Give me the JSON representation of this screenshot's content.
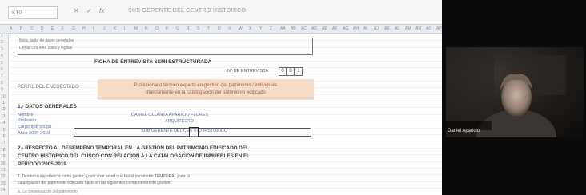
{
  "formula_bar": {
    "name_box": "K10",
    "icons": [
      "x-icon",
      "check-icon",
      "fx-icon"
    ],
    "formula": "SUB GERENTE DEL CENTRO HISTORICO"
  },
  "columns": [
    "A",
    "B",
    "C",
    "D",
    "E",
    "F",
    "G",
    "H",
    "I",
    "J",
    "K",
    "L",
    "M",
    "N",
    "O",
    "P",
    "Q",
    "R",
    "S",
    "T",
    "U",
    "V",
    "W",
    "X",
    "Y",
    "Z",
    "AA",
    "AB",
    "AC",
    "AD",
    "AE",
    "AF",
    "AG",
    "AH",
    "AI",
    "AJ",
    "AK",
    "AL",
    "AM",
    "AN",
    "AO",
    "AP"
  ],
  "rows": [
    "1",
    "2",
    "3",
    "4",
    "5",
    "6",
    "7",
    "8",
    "9",
    "10",
    "11",
    "12",
    "13",
    "14",
    "15",
    "16",
    "17",
    "18",
    "19",
    "20",
    "21",
    "22",
    "23",
    "24"
  ],
  "sheet": {
    "top_note_1": "Nota: tabla de datos generales",
    "top_note_2": "Llenar con letra clara y legible",
    "form_title": "FICHA DE ENTREVISTA SEMI ESTRUCTURADA",
    "interview_label": "N° DE ENTREVISTA",
    "interview_digits": [
      "0",
      "0",
      "1"
    ],
    "profile_label": "PERFIL DEL ENCUESTADO",
    "profile_line_1": "Profesional o técnico experto en gestión del patrimonio / individuals",
    "profile_line_2": "directamente en la catalogación del patrimonio edificado",
    "section1_title": "1.- DATOS GENERALES",
    "fields": [
      "Nombre",
      "Profesión",
      "Cargo que ocupa",
      "Años 2005-2019"
    ],
    "values": [
      "DANIEL OLLANTA APARICIO FLORES",
      "ARQUITECTO",
      "SUB GERENTE DEL CENTRO HISTORICO"
    ],
    "section2_line_1": "2.- RESPECTO AL DESEMPEÑO TEMPORAL EN LA GESTIÓN DEL PATRIMONIO EDIFICADO DEL",
    "section2_line_2": "CENTRO HISTÓRICO DEL CUSCO CON RELACIÓN A LA CATALOGACIÓN DE INMUEBLES EN EL",
    "section2_line_3": "PERIODO 2005-2019.",
    "question_line_1": "1. Desde su experiencia como gestor, ¿cuál cree usted que fue el parámetro TEMPORAL para la",
    "question_line_2": "catalogación del patrimonio edificado hasta en las siguientes componentes de gestión:",
    "question_line_3": "a. La conservación del patrimonio"
  },
  "video": {
    "participant_name": "Daniel Aparicio"
  }
}
